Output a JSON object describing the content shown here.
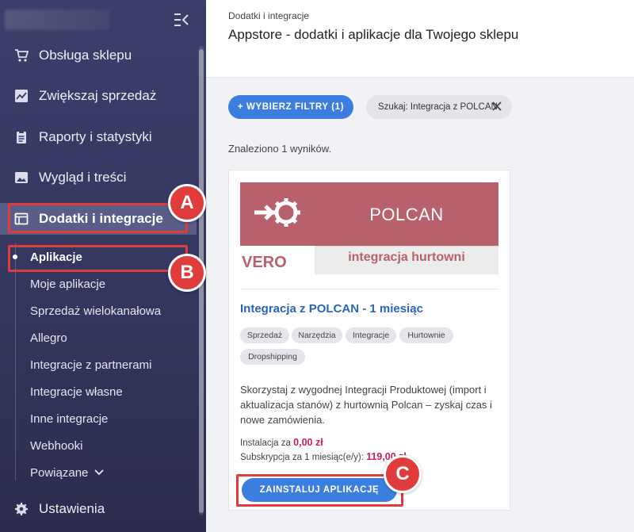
{
  "sidebar": {
    "items": [
      {
        "label": "Obsługa sklepu",
        "icon": "cart-icon"
      },
      {
        "label": "Zwiększaj sprzedaż",
        "icon": "trend-chart-icon"
      },
      {
        "label": "Raporty i statystyki",
        "icon": "clipboard-icon"
      },
      {
        "label": "Wygląd i treści",
        "icon": "image-icon"
      },
      {
        "label": "Dodatki i integracje",
        "icon": "window-icon"
      },
      {
        "label": "Ustawienia",
        "icon": "gear-icon"
      }
    ],
    "subitems": [
      {
        "label": "Aplikacje"
      },
      {
        "label": "Moje aplikacje"
      },
      {
        "label": "Sprzedaż wielokanałowa"
      },
      {
        "label": "Allegro"
      },
      {
        "label": "Integracje z partnerami"
      },
      {
        "label": "Integracje własne"
      },
      {
        "label": "Inne integracje"
      },
      {
        "label": "Webhooki"
      },
      {
        "label": "Powiązane"
      }
    ]
  },
  "header": {
    "breadcrumb": "Dodatki i integracje",
    "title": "Appstore - dodatki i aplikacje dla Twojego sklepu"
  },
  "toolbar": {
    "filters_label": "+ WYBIERZ FILTRY (1)",
    "search_chip": "Szukaj: Integracja z POLCAN"
  },
  "results_text": "Znaleziono 1 wyników.",
  "app": {
    "banner_brand": "POLCAN",
    "banner_tagline": "integracja hurtowni",
    "banner_logo": "VERO",
    "title": "Integracja z POLCAN - 1 miesiąc",
    "tags": [
      "Sprzedaż",
      "Narzędzia",
      "Integracje",
      "Hurtownie",
      "Dropshipping"
    ],
    "description": "Skorzystaj z wygodnej Integracji Produktowej (import i aktualizacja stanów) z hurtownią Polcan – zyskaj czas i nowe zamówienia.",
    "install_label": "Instalacja za",
    "install_price": "0,00 zł",
    "subscription_label": "Subskrypcja za 1 miesiąc(e/y):",
    "subscription_price": "119,00 zł",
    "install_button": "ZAINSTALUJ APLIKACJĘ"
  },
  "annotations": {
    "a": "A",
    "b": "B",
    "c": "C"
  },
  "colors": {
    "accent": "#3c7ee0",
    "highlight": "#e03c3c",
    "sidebar": "#3b3f6a",
    "price": "#d01c5e",
    "banner": "#b8606c"
  }
}
